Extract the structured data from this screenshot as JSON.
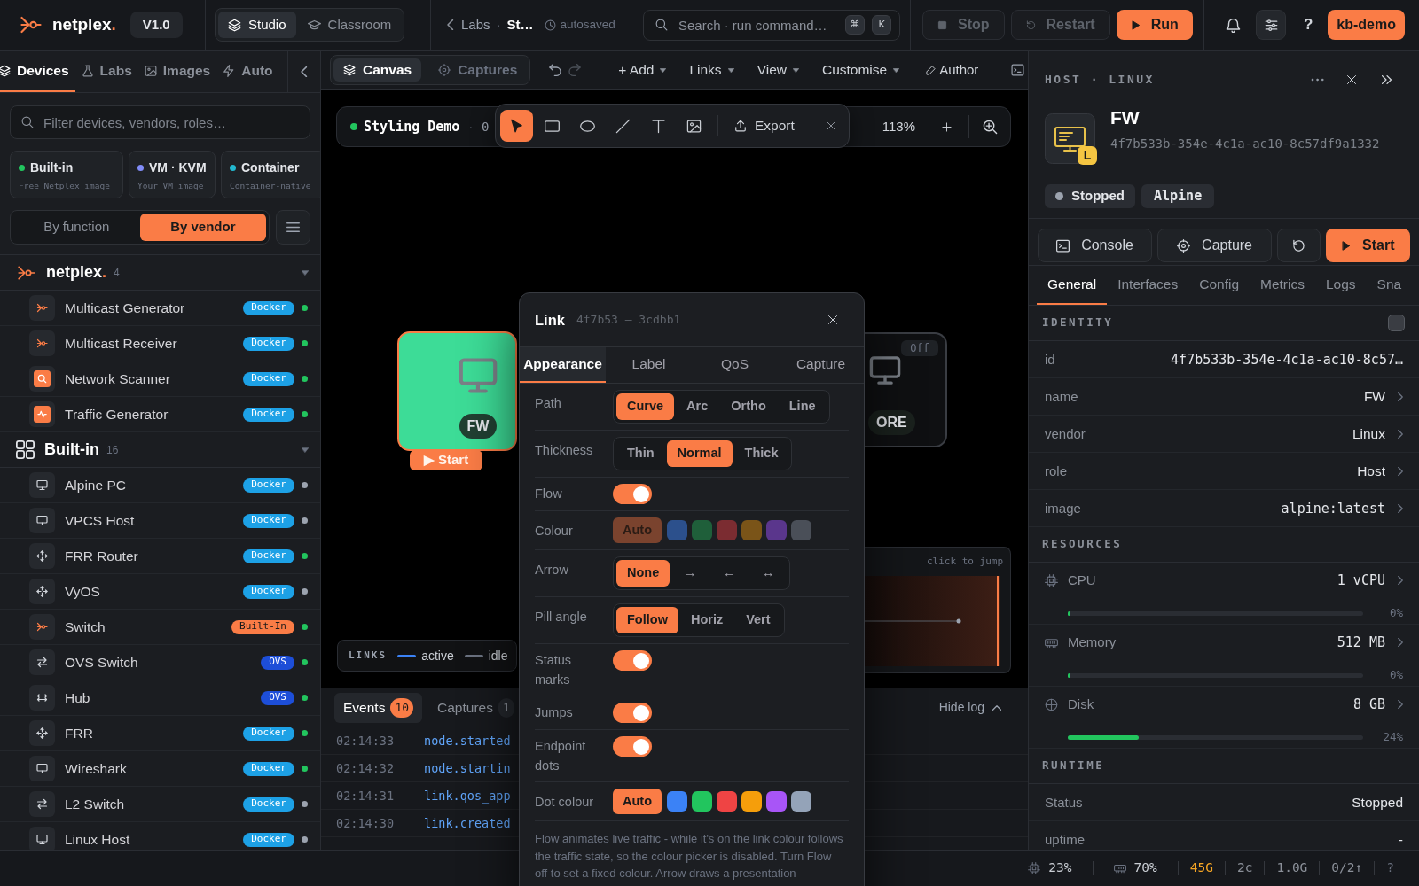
{
  "top_bar": {
    "logo": {
      "text": "netplex",
      "accent": "."
    },
    "version": "V1.0",
    "modes": [
      {
        "label": "Studio",
        "selected": true
      },
      {
        "label": "Classroom",
        "selected": false
      }
    ],
    "breadcrumb": {
      "parent": "Labs",
      "separator": "·",
      "current": "St…",
      "save_state": "autosaved"
    },
    "search": {
      "placeholder": "Search · run command…",
      "shortcut": [
        "⌘",
        "K"
      ]
    },
    "actions": [
      {
        "kind": "stop",
        "label": "Stop",
        "disabled": true
      },
      {
        "kind": "restart",
        "label": "Restart",
        "disabled": true
      },
      {
        "kind": "run",
        "label": "Run",
        "disabled": false
      }
    ],
    "help": "?",
    "account": "kb-demo"
  },
  "sidebar": {
    "tabs": [
      {
        "label": "Devices",
        "selected": true
      },
      {
        "label": "Labs",
        "selected": false
      },
      {
        "label": "Images",
        "selected": false
      },
      {
        "label": "Auto",
        "selected": false
      }
    ],
    "filter": {
      "placeholder": "Filter devices, vendors, roles…"
    },
    "sources": [
      {
        "title": "Built-in",
        "subtitle": "Free Netplex image",
        "color": "#22c55e"
      },
      {
        "title": "VM · KVM",
        "subtitle": "Your VM image",
        "color": "#818cf8"
      },
      {
        "title": "Container",
        "subtitle": "Container-native",
        "color": "#22b8cf"
      }
    ],
    "grouping": [
      {
        "label": "By function",
        "selected": false
      },
      {
        "label": "By vendor",
        "selected": true
      }
    ],
    "groups": [
      {
        "kind": "vendor",
        "name": "netplex",
        "accent": ".",
        "count": "4",
        "expanded": true,
        "devices": [
          {
            "kind": "native",
            "name": "Multicast Generator",
            "badge": {
              "text": "Docker",
              "color": "#1da1e6"
            },
            "color": "#22c55e"
          },
          {
            "kind": "native",
            "name": "Multicast Receiver",
            "badge": {
              "text": "Docker",
              "color": "#1da1e6"
            },
            "color": "#22c55e"
          },
          {
            "kind": "scanner",
            "name": "Network Scanner",
            "badge": {
              "text": "Docker",
              "color": "#1da1e6"
            },
            "color": "#22c55e"
          },
          {
            "kind": "traffic",
            "name": "Traffic Generator",
            "badge": {
              "text": "Docker",
              "color": "#1da1e6"
            },
            "color": "#22c55e"
          }
        ]
      },
      {
        "kind": "builtin",
        "name": "Built-in",
        "count": "16",
        "expanded": true,
        "devices": [
          {
            "kind": "host",
            "name": "Alpine PC",
            "badge": {
              "text": "Docker",
              "color": "#1da1e6"
            },
            "color": "#9ca3af"
          },
          {
            "kind": "host",
            "name": "VPCS Host",
            "badge": {
              "text": "Docker",
              "color": "#1da1e6"
            },
            "color": "#9ca3af"
          },
          {
            "kind": "router",
            "name": "FRR Router",
            "badge": {
              "text": "Docker",
              "color": "#1da1e6"
            },
            "color": "#22c55e"
          },
          {
            "kind": "router",
            "name": "VyOS",
            "badge": {
              "text": "Docker",
              "color": "#1da1e6"
            },
            "color": "#9ca3af"
          },
          {
            "kind": "native",
            "name": "Switch",
            "badge": {
              "text": "Built-In",
              "color": "#fa7c46"
            },
            "color": "#22c55e"
          },
          {
            "kind": "switch",
            "name": "OVS Switch",
            "badge": {
              "text": "OVS",
              "color": "#1d4ed8"
            },
            "color": "#22c55e"
          },
          {
            "kind": "hub",
            "name": "Hub",
            "badge": {
              "text": "OVS",
              "color": "#1d4ed8"
            },
            "color": "#22c55e"
          },
          {
            "kind": "router",
            "name": "FRR",
            "badge": {
              "text": "Docker",
              "color": "#1da1e6"
            },
            "color": "#22c55e"
          },
          {
            "kind": "host",
            "name": "Wireshark",
            "badge": {
              "text": "Docker",
              "color": "#1da1e6"
            },
            "color": "#22c55e"
          },
          {
            "kind": "switch",
            "name": "L2 Switch",
            "badge": {
              "text": "Docker",
              "color": "#1da1e6"
            },
            "color": "#9ca3af"
          },
          {
            "kind": "host",
            "name": "Linux Host",
            "badge": {
              "text": "Docker",
              "color": "#1da1e6"
            },
            "color": "#9ca3af"
          }
        ]
      }
    ]
  },
  "workspace": {
    "tabs": [
      {
        "label": "Canvas",
        "selected": true
      },
      {
        "label": "Captures",
        "selected": false
      }
    ],
    "menus": [
      {
        "label": "+ Add"
      },
      {
        "label": "Links"
      },
      {
        "label": "View"
      },
      {
        "label": "Customise"
      }
    ],
    "author": "Author",
    "canvas": {
      "lab": {
        "name": "Styling Demo",
        "color": "#22c55e",
        "separator": "·",
        "counter": "0"
      },
      "tools": [
        {
          "kind": "select",
          "selected": true
        },
        {
          "kind": "rectangle",
          "selected": false
        },
        {
          "kind": "ellipse",
          "selected": false
        },
        {
          "kind": "line",
          "selected": false
        },
        {
          "kind": "text",
          "selected": false
        },
        {
          "kind": "image",
          "selected": false
        }
      ],
      "export": "Export",
      "zoom": "113%",
      "nodes": [
        {
          "label": "FW",
          "selected": true,
          "color": "#3ddc97",
          "action": "▶ Start"
        },
        {
          "label": "ORE",
          "selected": false,
          "color": "#0f1012",
          "badge": "Off"
        }
      ],
      "legend": {
        "title": "LINKS",
        "items": [
          {
            "label": "active",
            "color": "#3b82f6"
          },
          {
            "label": "idle",
            "color": "#6b7280"
          }
        ]
      },
      "minimap": {
        "hint": "click to jump"
      }
    },
    "log": {
      "tabs": [
        {
          "label": "Events",
          "count": "10",
          "selected": true
        },
        {
          "label": "Captures",
          "count": "1",
          "selected": false
        }
      ],
      "toggle": "Hide log",
      "rows": [
        {
          "time": "02:14:33",
          "event": "node.started"
        },
        {
          "time": "02:14:32",
          "event": "node.startin"
        },
        {
          "time": "02:14:31",
          "event": "link.qos_app"
        },
        {
          "time": "02:14:30",
          "event": "link.created"
        }
      ]
    }
  },
  "inspector": {
    "heading": "HOST · LINUX",
    "name": "FW",
    "uuid": "4f7b533b-354e-4c1a-ac10-8c57df9a1332",
    "os_badge": "L",
    "tags": [
      {
        "kind": "status",
        "label": "Stopped",
        "color": "#9ca3af"
      },
      {
        "kind": "image",
        "label": "Alpine"
      }
    ],
    "actions": [
      {
        "kind": "console",
        "label": "Console"
      },
      {
        "kind": "capture",
        "label": "Capture"
      },
      {
        "kind": "restart"
      },
      {
        "kind": "start",
        "label": "Start"
      }
    ],
    "tabs": [
      {
        "label": "General",
        "selected": true
      },
      {
        "label": "Interfaces",
        "selected": false
      },
      {
        "label": "Config",
        "selected": false
      },
      {
        "label": "Metrics",
        "selected": false
      },
      {
        "label": "Logs",
        "selected": false
      },
      {
        "label": "Sna",
        "selected": false
      }
    ],
    "sections": [
      {
        "title": "IDENTITY",
        "kind": "fields",
        "checkbox": {
          "checked": false
        },
        "rows": [
          {
            "label": "id",
            "value": "4f7b533b-354e-4c1a-ac10-8c57…",
            "kind": "code",
            "editable": false
          },
          {
            "label": "name",
            "value": "FW",
            "kind": "text",
            "editable": true
          },
          {
            "label": "vendor",
            "value": "Linux",
            "kind": "text",
            "editable": true
          },
          {
            "label": "role",
            "value": "Host",
            "kind": "text",
            "editable": true
          },
          {
            "label": "image",
            "value": "alpine:latest",
            "kind": "code",
            "editable": true
          }
        ]
      },
      {
        "title": "RESOURCES",
        "kind": "meters",
        "rows": [
          {
            "kind": "cpu",
            "label": "CPU",
            "value": "1 vCPU",
            "level": 0,
            "reading": "0%"
          },
          {
            "kind": "memory",
            "label": "Memory",
            "value": "512 MB",
            "level": 0,
            "reading": "0%"
          },
          {
            "kind": "disk",
            "label": "Disk",
            "value": "8 GB",
            "level": 0.24,
            "reading": "24%"
          }
        ]
      },
      {
        "title": "RUNTIME",
        "kind": "fields",
        "rows": [
          {
            "label": "Status",
            "value": "Stopped",
            "kind": "text",
            "editable": false
          },
          {
            "label": "uptime",
            "value": "-",
            "kind": "text",
            "editable": false
          }
        ]
      }
    ]
  },
  "status_bar": {
    "items": [
      {
        "kind": "cpu",
        "text": "23%",
        "color": "#c9cdd3"
      },
      {
        "kind": "memory",
        "text": "70%",
        "color": "#c9cdd3"
      },
      {
        "kind": "plain",
        "text": "45G",
        "color": "#f5a524"
      },
      {
        "kind": "plain",
        "text": "2c",
        "color": "#8b9099"
      },
      {
        "kind": "plain",
        "text": "1.0G",
        "color": "#8b9099"
      },
      {
        "kind": "plain",
        "text": "0/2↑",
        "color": "#8b9099"
      },
      {
        "kind": "plain",
        "text": "?",
        "color": "#6b7280"
      }
    ]
  },
  "link_dialog": {
    "title": "Link",
    "endpoints": "4f7b53 — 3cdbb1",
    "tabs": [
      {
        "label": "Appearance",
        "selected": true
      },
      {
        "label": "Label",
        "selected": false
      },
      {
        "label": "QoS",
        "selected": false
      },
      {
        "label": "Capture",
        "selected": false
      }
    ],
    "settings": [
      {
        "kind": "choice",
        "label": "Path",
        "options": [
          {
            "label": "Curve",
            "selected": true
          },
          {
            "label": "Arc",
            "selected": false
          },
          {
            "label": "Ortho",
            "selected": false
          },
          {
            "label": "Line",
            "selected": false
          }
        ]
      },
      {
        "kind": "choice",
        "label": "Thickness",
        "options": [
          {
            "label": "Thin",
            "selected": false
          },
          {
            "label": "Normal",
            "selected": true
          },
          {
            "label": "Thick",
            "selected": false
          }
        ]
      },
      {
        "kind": "toggle",
        "label": "Flow",
        "on": true
      },
      {
        "kind": "colours",
        "label": "Colour",
        "disabled": true,
        "auto": {
          "label": "Auto",
          "selected": true
        },
        "swatches": [
          {
            "color": "#2c508c",
            "selected": false
          },
          {
            "color": "#1f5f3a",
            "selected": false
          },
          {
            "color": "#7b2c31",
            "selected": false
          },
          {
            "color": "#7a5418",
            "selected": false
          },
          {
            "color": "#5a368c",
            "selected": false
          },
          {
            "color": "#4a4f58",
            "selected": false
          }
        ]
      },
      {
        "kind": "choice",
        "label": "Arrow",
        "options": [
          {
            "label": "None",
            "selected": true
          },
          {
            "label": "→",
            "selected": false
          },
          {
            "label": "←",
            "selected": false
          },
          {
            "label": "↔",
            "selected": false
          }
        ]
      },
      {
        "kind": "choice",
        "label": "Pill angle",
        "options": [
          {
            "label": "Follow",
            "selected": true
          },
          {
            "label": "Horiz",
            "selected": false
          },
          {
            "label": "Vert",
            "selected": false
          }
        ]
      },
      {
        "kind": "toggle",
        "label": "Status marks",
        "on": true
      },
      {
        "kind": "toggle",
        "label": "Jumps",
        "on": true
      },
      {
        "kind": "toggle",
        "label": "Endpoint dots",
        "on": true
      },
      {
        "kind": "colours",
        "label": "Dot colour",
        "disabled": false,
        "auto": {
          "label": "Auto",
          "selected": true
        },
        "swatches": [
          {
            "color": "#3b82f6",
            "selected": false
          },
          {
            "color": "#22c55e",
            "selected": false
          },
          {
            "color": "#ef4444",
            "selected": false
          },
          {
            "color": "#f59e0b",
            "selected": false
          },
          {
            "color": "#a855f7",
            "selected": false
          },
          {
            "color": "#94a3b8",
            "selected": false
          }
        ]
      }
    ],
    "note": "Flow animates live traffic - while it's on the link colour follows the traffic state, so the colour picker is disabled. Turn Flow off to set a fixed colour. Arrow draws a presentation"
  }
}
